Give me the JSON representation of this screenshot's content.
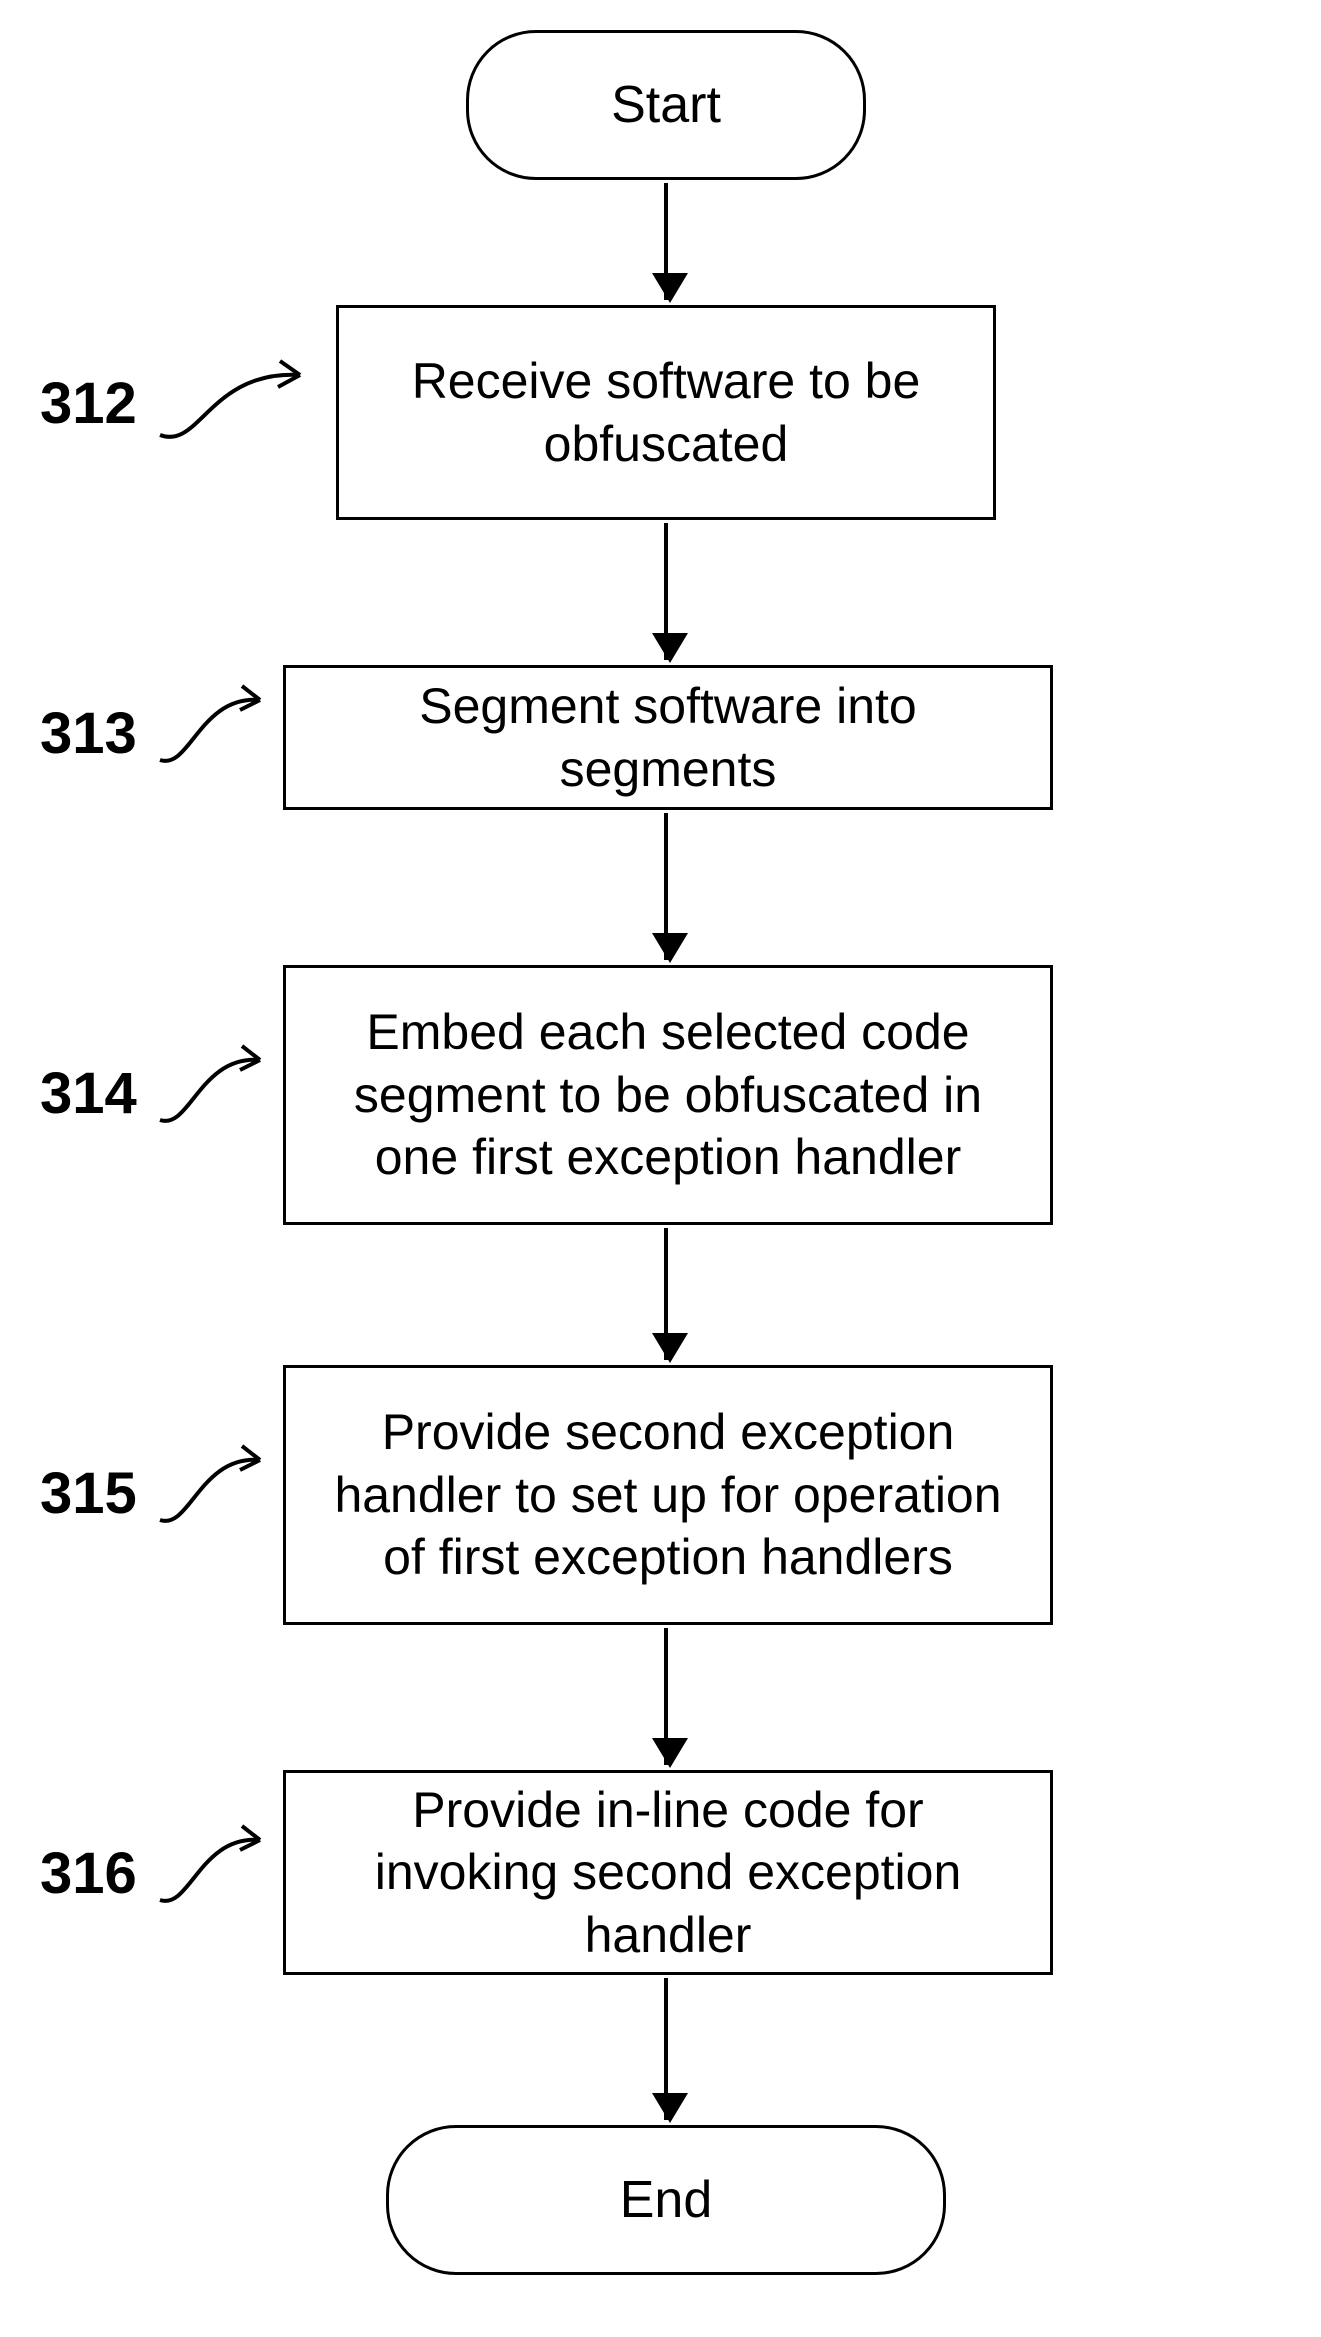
{
  "terminators": {
    "start": "Start",
    "end": "End"
  },
  "steps": {
    "s312": {
      "ref": "312",
      "text": "Receive software to be obfuscated"
    },
    "s313": {
      "ref": "313",
      "text": "Segment software into segments"
    },
    "s314": {
      "ref": "314",
      "text": "Embed each selected code segment to be obfuscated in one first exception handler"
    },
    "s315": {
      "ref": "315",
      "text": "Provide second exception handler to set up for operation of first exception handlers"
    },
    "s316": {
      "ref": "316",
      "text": "Provide in-line code for invoking second exception handler"
    }
  }
}
